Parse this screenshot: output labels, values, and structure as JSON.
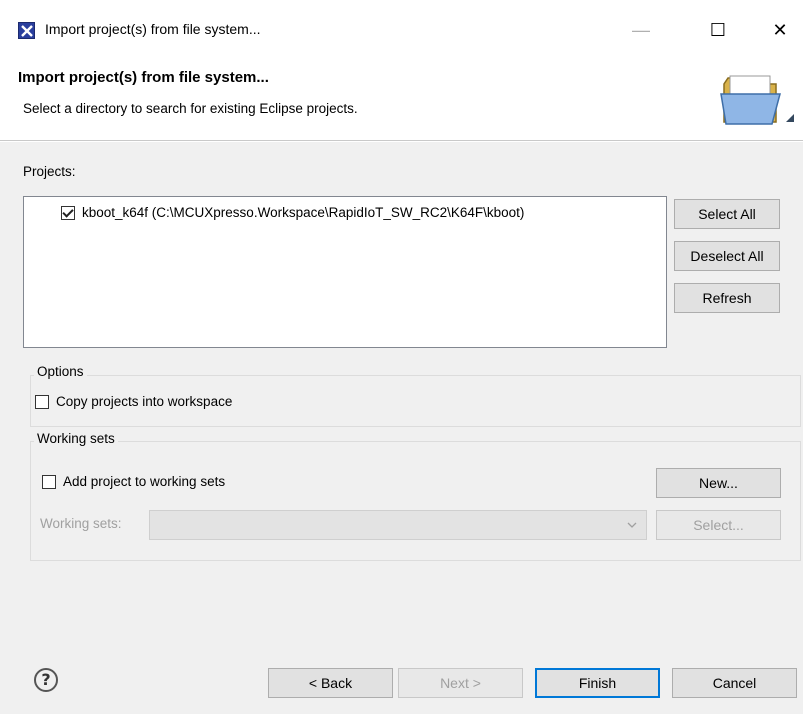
{
  "window": {
    "title": "Import project(s) from file system...",
    "controls": {
      "minimize": "—",
      "maximize": "☐",
      "close": "✕"
    }
  },
  "banner": {
    "title": "Import project(s) from file system...",
    "description": "Select a directory to search for existing Eclipse projects.",
    "icon": "open-folder-icon"
  },
  "projects": {
    "label": "Projects:",
    "items": [
      {
        "label": "kboot_k64f (C:\\MCUXpresso.Workspace\\RapidIoT_SW_RC2\\K64F\\kboot)",
        "checked": true
      }
    ],
    "buttons": {
      "select_all": "Select All",
      "deselect_all": "Deselect All",
      "refresh": "Refresh"
    }
  },
  "options": {
    "legend": "Options",
    "copy_projects": {
      "label": "Copy projects into workspace",
      "checked": false
    }
  },
  "working_sets": {
    "legend": "Working sets",
    "add_project": {
      "label": "Add project to working sets",
      "checked": false
    },
    "new_button": "New...",
    "field_label": "Working sets:",
    "select_value": "",
    "select_button": "Select..."
  },
  "footer": {
    "help": "?",
    "back": "< Back",
    "next": "Next >",
    "finish": "Finish",
    "cancel": "Cancel"
  },
  "colors": {
    "accent": "#0078d7",
    "app_icon": "#2a3f9e"
  }
}
